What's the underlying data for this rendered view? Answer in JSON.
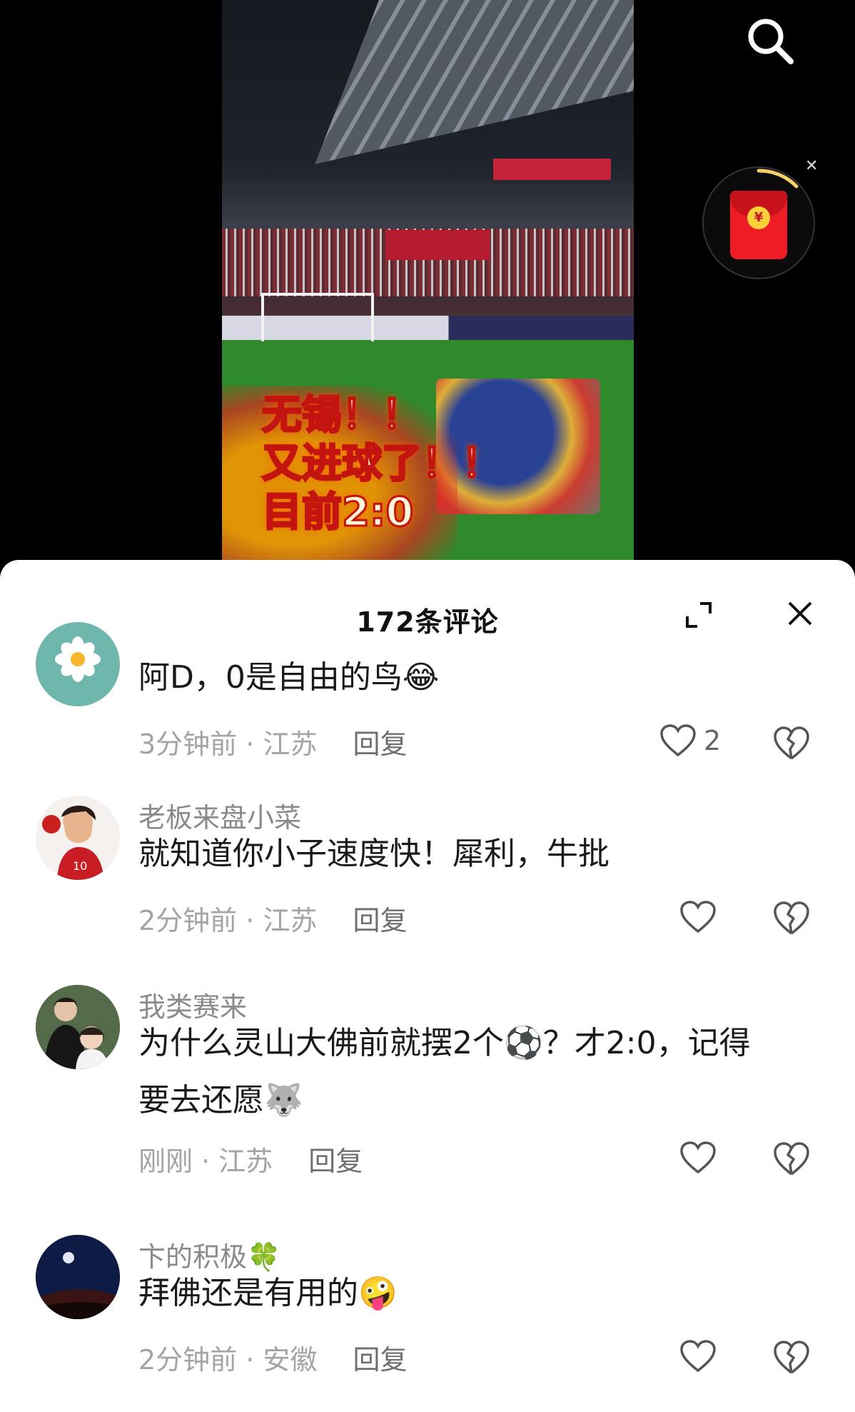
{
  "video": {
    "overlay_lines": [
      "无锡！！",
      "又进球了！！",
      "目前2:0"
    ],
    "accent_red": "#ee1d25"
  },
  "header": {
    "comment_count": "172条评论"
  },
  "comments": [
    {
      "username": "",
      "text": "阿D，0是自由的鸟",
      "emoji": "😂",
      "time": "3分钟前",
      "location": "江苏",
      "reply_label": "回复",
      "likes": "2",
      "avatar": "flower-avatar"
    },
    {
      "username": "老板来盘小菜",
      "text": "就知道你小子速度快！犀利，牛批",
      "emoji": "",
      "time": "2分钟前",
      "location": "江苏",
      "reply_label": "回复",
      "likes": "",
      "avatar": "basketball-player-avatar"
    },
    {
      "username": "我类赛来",
      "text_line1": "为什么灵山大佛前就摆2个",
      "emoji_inline": "⚽",
      "text_line1_end": "？才2:0，记得",
      "text_line2": "要去还愿",
      "emoji": "🐺",
      "time": "刚刚",
      "location": "江苏",
      "reply_label": "回复",
      "likes": "",
      "avatar": "couple-photo-avatar"
    },
    {
      "username": "卞的积极",
      "username_emoji": "🍀",
      "text": "拜佛还是有用的",
      "emoji": "🤪",
      "time": "2分钟前",
      "location": "安徽",
      "reply_label": "回复",
      "likes": "",
      "avatar": "night-moon-avatar"
    }
  ]
}
